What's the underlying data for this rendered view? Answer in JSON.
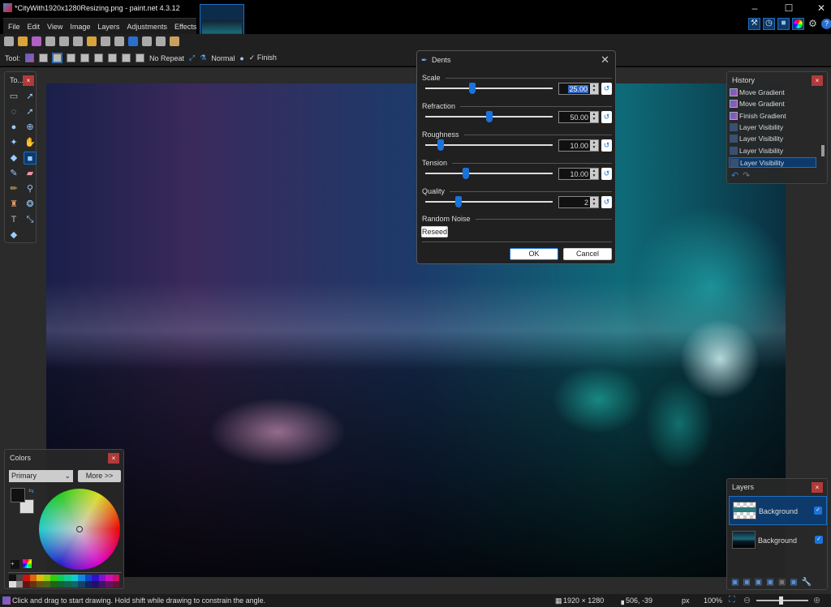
{
  "window": {
    "title": "*CityWith1920x1280Resizing.png - paint.net 4.3.12",
    "minimize": "–",
    "maximize": "☐",
    "close": "✕"
  },
  "menu": [
    "File",
    "Edit",
    "View",
    "Image",
    "Layers",
    "Adjustments",
    "Effects"
  ],
  "options": {
    "tool_label": "Tool:",
    "repeat": "No Repeat",
    "blend": "Normal",
    "finish": "Finish"
  },
  "tools_panel": {
    "title": "To...",
    "close": "×"
  },
  "dialog": {
    "title": "Dents",
    "close": "✕",
    "properties": [
      {
        "label": "Scale",
        "value": "25.00",
        "position": 0.37
      },
      {
        "label": "Refraction",
        "value": "50.00",
        "position": 0.5
      },
      {
        "label": "Roughness",
        "value": "10.00",
        "position": 0.12
      },
      {
        "label": "Tension",
        "value": "10.00",
        "position": 0.32
      },
      {
        "label": "Quality",
        "value": "2",
        "position": 0.26
      }
    ],
    "random_noise": "Random Noise",
    "reseed": "Reseed",
    "ok": "OK",
    "cancel": "Cancel"
  },
  "history": {
    "title": "History",
    "close": "×",
    "items": [
      "Move Gradient",
      "Move Gradient",
      "Finish Gradient",
      "Layer Visibility",
      "Layer Visibility",
      "Layer Visibility",
      "Layer Visibility"
    ],
    "selected": 6
  },
  "colors": {
    "title": "Colors",
    "close": "×",
    "mode": "Primary",
    "more": "More >>",
    "palette_top": [
      "#111111",
      "#444444",
      "#cc1111",
      "#dd6611",
      "#ddbb11",
      "#99cc11",
      "#33cc11",
      "#11cc55",
      "#11cc99",
      "#11cccc",
      "#1188dd",
      "#1144cc",
      "#3311cc",
      "#8811cc",
      "#cc11bb",
      "#cc1166"
    ],
    "palette_bottom": [
      "#dddddd",
      "#888888",
      "#661111",
      "#663311",
      "#665511",
      "#4d6611",
      "#1f6611",
      "#116633",
      "#11664d",
      "#116666",
      "#114466",
      "#112266",
      "#1f1166",
      "#441166",
      "#66115d",
      "#661133"
    ]
  },
  "layers": {
    "title": "Layers",
    "close": "×",
    "items": [
      {
        "name": "Background",
        "visible": true,
        "selected": true
      },
      {
        "name": "Background",
        "visible": true,
        "selected": false
      }
    ]
  },
  "status": {
    "hint": "Click and drag to start drawing. Hold shift while drawing to constrain the angle.",
    "size": "1920 × 1280",
    "cursor": "506, -39",
    "unit": "px",
    "zoom": "100%"
  },
  "accent": "#1a73d9"
}
